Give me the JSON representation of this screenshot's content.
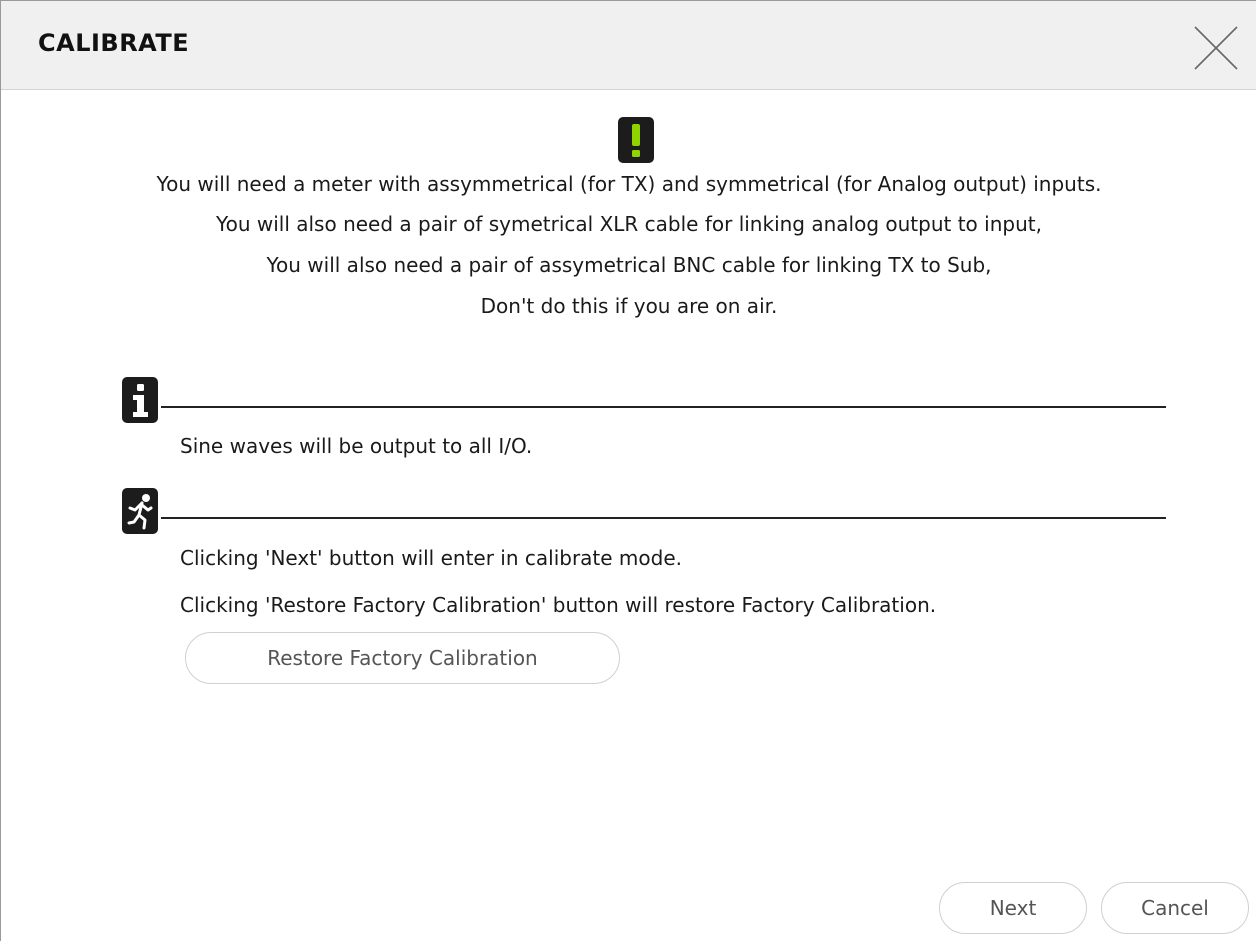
{
  "dialog": {
    "title": "CALIBRATE",
    "close_icon": "close-icon"
  },
  "warning": {
    "icon": "exclamation-warning-icon",
    "icon_color": "#8fd400",
    "lines": [
      "You will need a meter with assymmetrical (for TX) and symmetrical (for Analog output) inputs.",
      "You will also need a pair of symetrical XLR cable for linking analog output to input,",
      "You will also need a pair of assymetrical BNC cable for linking TX to Sub,",
      "Don't do this if you are on air."
    ]
  },
  "info": {
    "icon": "info-icon",
    "text": "Sine waves will be output to all I/O."
  },
  "action": {
    "icon": "running-man-icon",
    "line1": "Clicking 'Next' button will enter in calibrate mode.",
    "line2": "Clicking 'Restore Factory Calibration' button will restore Factory Calibration.",
    "restore_label": "Restore Factory Calibration"
  },
  "footer": {
    "next_label": "Next",
    "cancel_label": "Cancel"
  }
}
